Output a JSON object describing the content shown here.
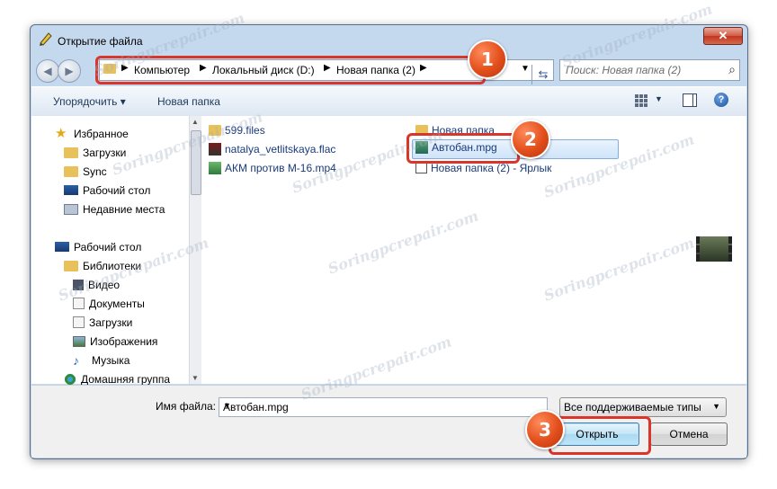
{
  "window": {
    "title": "Открытие файла",
    "close_label": "✕"
  },
  "address": {
    "crumbs": [
      "Компьютер",
      "Локальный диск (D:)",
      "Новая папка (2)"
    ],
    "search_placeholder": "Поиск: Новая папка (2)"
  },
  "toolbar": {
    "organize": "Упорядочить ▾",
    "new_folder": "Новая папка"
  },
  "nav": {
    "favorites": "Избранное",
    "downloads": "Загрузки",
    "sync": "Sync",
    "desktop": "Рабочий стол",
    "recent": "Недавние места",
    "desktop2": "Рабочий стол",
    "libraries": "Библиотеки",
    "video": "Видео",
    "documents": "Документы",
    "downloads2": "Загрузки",
    "images": "Изображения",
    "music": "Музыка",
    "homegroup": "Домашняя группа"
  },
  "files": {
    "f1": "599.files",
    "f2": "natalya_vetlitskaya.flac",
    "f3": "АКМ против М-16.mp4",
    "f4": "Новая папка",
    "f5": "Автобан.mpg",
    "f6": "Новая папка (2) - Ярлык"
  },
  "bottom": {
    "filename_label": "Имя файла:",
    "filename_value": "Автобан.mpg",
    "filetype": "Все поддерживаемые типы",
    "open": "Открыть",
    "cancel": "Отмена"
  },
  "annotations": {
    "b1": "1",
    "b2": "2",
    "b3": "3"
  },
  "watermark": "Soringpcrepair.com",
  "colors": {
    "highlight": "#d9352a",
    "badge": "#e24e1b",
    "link": "#1a3a7a"
  }
}
